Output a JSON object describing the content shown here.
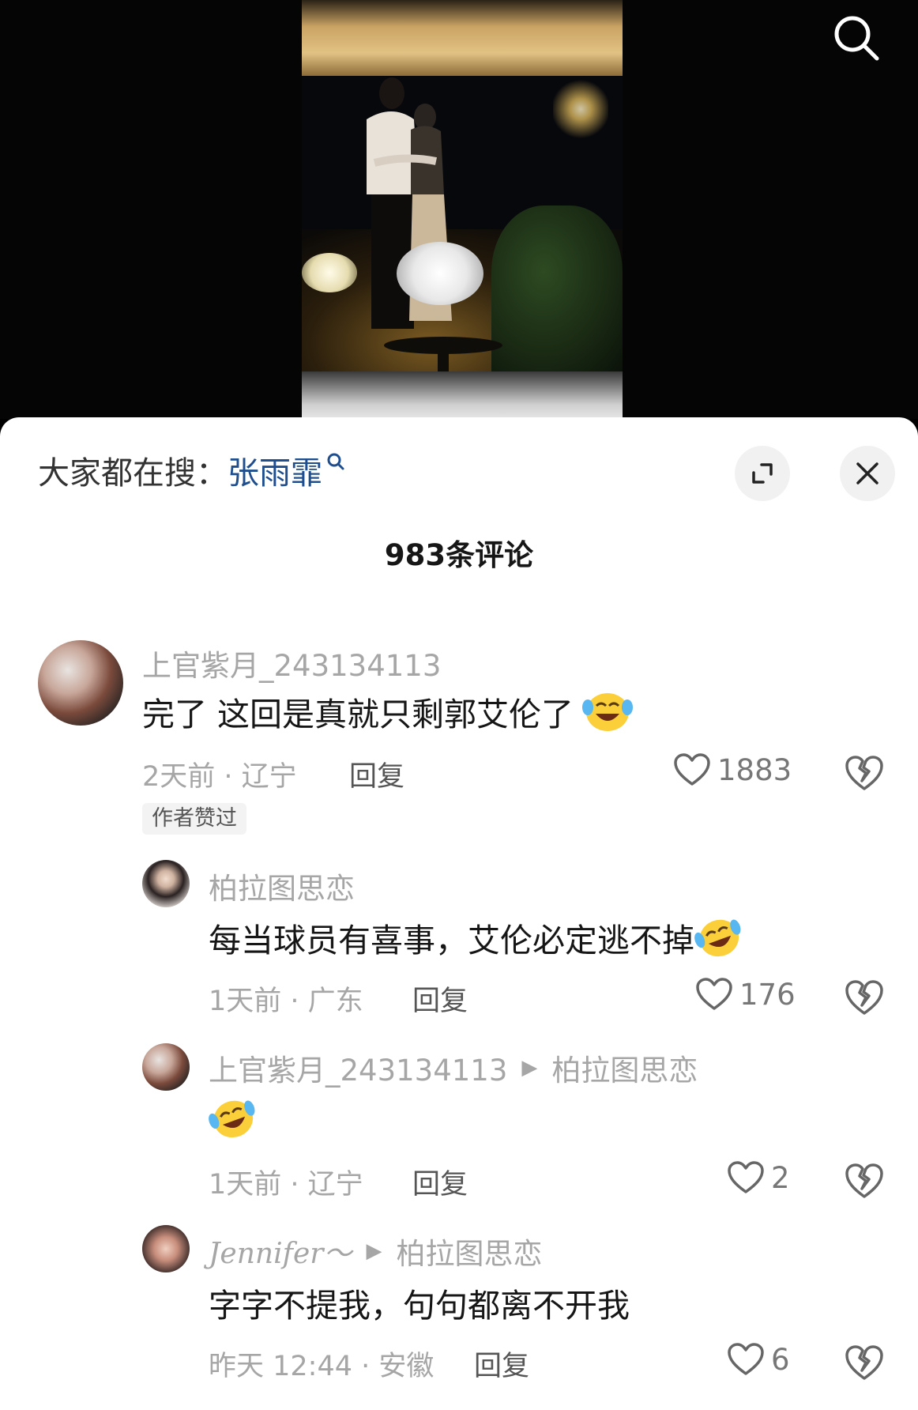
{
  "video": {
    "description_hidden": ""
  },
  "sheet": {
    "hot_search_label": "大家都在搜：",
    "hot_search_term": "张雨霏",
    "comment_count": "983条评论"
  },
  "comments": [
    {
      "user": "上官紫月_243134113",
      "text": "完了 这回是真就只剩郭艾伦了",
      "meta": "2天前 · 辽宁",
      "reply": "回复",
      "likes": "1883",
      "badge": "作者赞过"
    },
    {
      "user": "柏拉图思恋",
      "text": "每当球员有喜事，艾伦必定逃不掉",
      "meta": "1天前 · 广东",
      "reply": "回复",
      "likes": "176"
    },
    {
      "user": "上官紫月_243134113",
      "reply_to": "柏拉图思恋",
      "text": "",
      "meta": "1天前 · 辽宁",
      "reply": "回复",
      "likes": "2"
    },
    {
      "user": "Jennifer～",
      "reply_to": "柏拉图思恋",
      "text": "字字不提我，句句都离不开我",
      "meta": "昨天 12:44 · 安徽",
      "reply": "回复",
      "likes": "6"
    }
  ],
  "icons": {
    "search": "search-icon",
    "expand": "expand-icon",
    "close": "close-icon",
    "like": "heart-icon",
    "dislike": "broken-heart-icon",
    "emoji": "laughing-crying-emoji"
  },
  "colors": {
    "link_blue": "#1f4e8f",
    "muted": "#a6a6a6",
    "text": "#161616"
  }
}
